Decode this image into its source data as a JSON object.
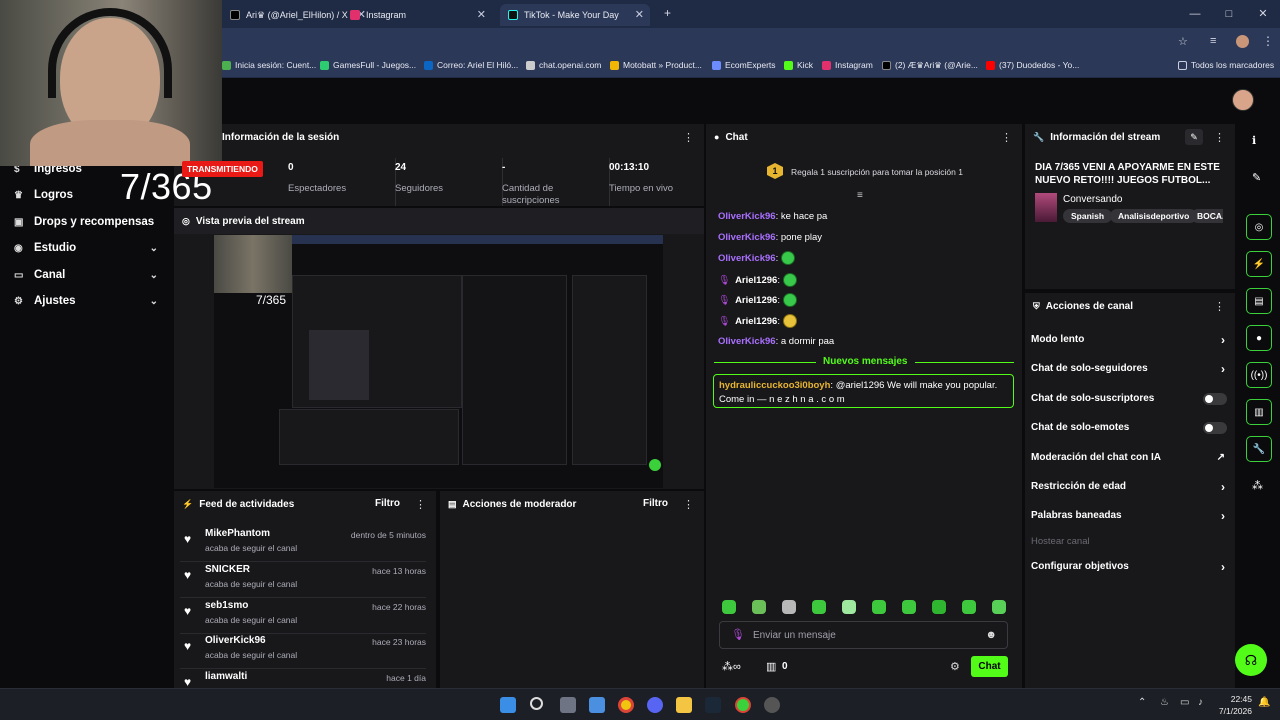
{
  "browser": {
    "tabs": [
      {
        "label": "Ari♛ (@Ariel_ElHilon) / X",
        "color": "#000000"
      },
      {
        "label": "Instagram",
        "color": "#e1306c"
      },
      {
        "label": "TikTok - Make Your Day",
        "color": "#111111"
      }
    ],
    "new_tab": "+",
    "window_controls": [
      "—",
      "□",
      "✕"
    ]
  },
  "bookmarks": [
    {
      "label": "Inicia sesión: Cuent...",
      "color": "#4caf50"
    },
    {
      "label": "GamesFull - Juegos...",
      "color": "#2ecc71"
    },
    {
      "label": "Correo: Ariel El Hiló...",
      "color": "#0a66c2"
    },
    {
      "label": "chat.openai.com",
      "color": "#cccccc"
    },
    {
      "label": "Motobatt » Product...",
      "color": "#f2b705"
    },
    {
      "label": "EcomExperts",
      "color": "#6c8cff"
    },
    {
      "label": "Kick",
      "color": "#53fc18"
    },
    {
      "label": "Instagram",
      "color": "#e1306c"
    },
    {
      "label": "(2) Æ♛Ari♛ (@Arie...",
      "color": "#000000"
    },
    {
      "label": "(37) Duodedos - Yo...",
      "color": "#ff0000"
    },
    {
      "label": "Todos los marcadores",
      "color": "#c9cee0"
    }
  ],
  "overlay": {
    "counter": "7/365"
  },
  "sidebar": {
    "items": [
      {
        "label": "Ingresos",
        "icon": "dollar-icon",
        "chevron": false
      },
      {
        "label": "Logros",
        "icon": "trophy-icon",
        "chevron": false
      },
      {
        "label": "Drops y recompensas",
        "icon": "gift-icon",
        "chevron": false
      },
      {
        "label": "Estudio",
        "icon": "studio-icon",
        "chevron": true
      },
      {
        "label": "Canal",
        "icon": "channel-icon",
        "chevron": true
      },
      {
        "label": "Ajustes",
        "icon": "gear-icon",
        "chevron": true
      }
    ]
  },
  "session": {
    "title": "Información de la sesión",
    "badge": "TRANSMITIENDO",
    "stats": [
      {
        "value": "0",
        "label": "Espectadores"
      },
      {
        "value": "24",
        "label": "Seguidores"
      },
      {
        "value": "-",
        "label": "Cantidad de suscripciones"
      },
      {
        "value": "00:13:10",
        "label": "Tiempo en vivo"
      }
    ]
  },
  "preview": {
    "title": "Vista previa del stream"
  },
  "feed": {
    "title": "Feed de actividades",
    "filter": "Filtro",
    "items": [
      {
        "name": "MikePhantom",
        "action": "acaba de seguir el canal",
        "time": "dentro de 5 minutos"
      },
      {
        "name": "SNICKER",
        "action": "acaba de seguir el canal",
        "time": "hace 13 horas"
      },
      {
        "name": "seb1smo",
        "action": "acaba de seguir el canal",
        "time": "hace 22 horas"
      },
      {
        "name": "OliverKick96",
        "action": "acaba de seguir el canal",
        "time": "hace 23 horas"
      },
      {
        "name": "liamwalti",
        "action": "",
        "time": "hace 1 día"
      }
    ]
  },
  "moderator": {
    "title": "Acciones de moderador",
    "filter": "Filtro"
  },
  "chat": {
    "title": "Chat",
    "gift_rank": "1",
    "gift_text": "Regala 1 suscripción para tomar la posición 1",
    "messages": [
      {
        "user": "OliverKick96",
        "text": "ke hace pa",
        "color": "#a970ff",
        "mic": false,
        "emojis": 0
      },
      {
        "user": "OliverKick96",
        "text": "pone play",
        "color": "#a970ff",
        "mic": false,
        "emojis": 0
      },
      {
        "user": "OliverKick96",
        "text": "",
        "color": "#a970ff",
        "mic": false,
        "emojis": 1
      },
      {
        "user": "Ariel1296",
        "text": "",
        "color": "#ffffff",
        "mic": true,
        "emojis": 1
      },
      {
        "user": "Ariel1296",
        "text": "",
        "color": "#ffffff",
        "mic": true,
        "emojis": 1
      },
      {
        "user": "Ariel1296",
        "text": "",
        "color": "#ffffff",
        "mic": true,
        "emojis": 1
      },
      {
        "user": "OliverKick96",
        "text": "a dormir paa",
        "color": "#a970ff",
        "mic": false,
        "emojis": 0
      }
    ],
    "new_messages": "Nuevos mensajes",
    "highlight_user": "hydrauliccuckoo3i0boyh",
    "highlight_text_1": "@ariel1296 We will make you popular.",
    "highlight_text_2": "Come in — n e z h n a . c o m",
    "input_placeholder": "Enviar un mensaje",
    "points": "0",
    "send_label": "Chat"
  },
  "stream_info": {
    "title": "Información del stream",
    "stream_title": "DIA 7/365 VENI A APOYARME EN ESTE NUEVO RETO!!!! JUEGOS FUTBOL...",
    "category": "Conversando",
    "tags": [
      "Spanish",
      "Analisisdeportivo",
      "BOCA..."
    ]
  },
  "channel_actions": {
    "title": "Acciones de canal",
    "items": [
      {
        "label": "Modo lento",
        "kind": "arrow"
      },
      {
        "label": "Chat de solo-seguidores",
        "kind": "arrow"
      },
      {
        "label": "Chat de solo-suscriptores",
        "kind": "toggle"
      },
      {
        "label": "Chat de solo-emotes",
        "kind": "toggle"
      },
      {
        "label": "Moderación del chat con IA",
        "kind": "external"
      },
      {
        "label": "Restricción de edad",
        "kind": "arrow"
      },
      {
        "label": "Palabras baneadas",
        "kind": "arrow"
      },
      {
        "label": "Hostear canal",
        "kind": "disabled"
      },
      {
        "label": "Configurar objetivos",
        "kind": "arrow"
      }
    ]
  },
  "taskbar": {
    "time": "22:45",
    "date": "7/1/2026"
  },
  "colors": {
    "accent": "#53fc18",
    "live": "#e91916",
    "panel": "#18181b",
    "background": "#0b0b0d"
  }
}
